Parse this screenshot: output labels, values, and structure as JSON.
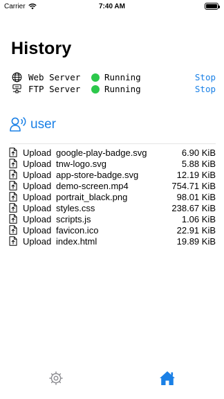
{
  "status_bar": {
    "carrier": "Carrier",
    "time": "7:40 AM"
  },
  "page_title": "History",
  "servers": [
    {
      "name": "Web Server",
      "status": "Running",
      "action": "Stop",
      "icon": "globe-icon"
    },
    {
      "name": "FTP Server",
      "status": "Running",
      "action": "Stop",
      "icon": "network-icon"
    }
  ],
  "user": {
    "name": "user",
    "icon": "user-wave-icon"
  },
  "log": [
    {
      "action": "Upload",
      "file": "google-play-badge.svg",
      "size": "6.90 KiB"
    },
    {
      "action": "Upload",
      "file": "tnw-logo.svg",
      "size": "5.88 KiB"
    },
    {
      "action": "Upload",
      "file": "app-store-badge.svg",
      "size": "12.19 KiB"
    },
    {
      "action": "Upload",
      "file": "demo-screen.mp4",
      "size": "754.71 KiB"
    },
    {
      "action": "Upload",
      "file": "portrait_black.png",
      "size": "98.01 KiB"
    },
    {
      "action": "Upload",
      "file": "styles.css",
      "size": "238.67 KiB"
    },
    {
      "action": "Upload",
      "file": "scripts.js",
      "size": "1.06 KiB"
    },
    {
      "action": "Upload",
      "file": "favicon.ico",
      "size": "22.91 KiB"
    },
    {
      "action": "Upload",
      "file": "index.html",
      "size": "19.89 KiB"
    }
  ],
  "tabs": [
    {
      "icon": "settings-icon",
      "selected": false
    },
    {
      "icon": "home-icon",
      "selected": true
    }
  ],
  "colors": {
    "accent": "#1a80e6",
    "running": "#2cc84b",
    "inactive_tab": "#8e8e93"
  }
}
